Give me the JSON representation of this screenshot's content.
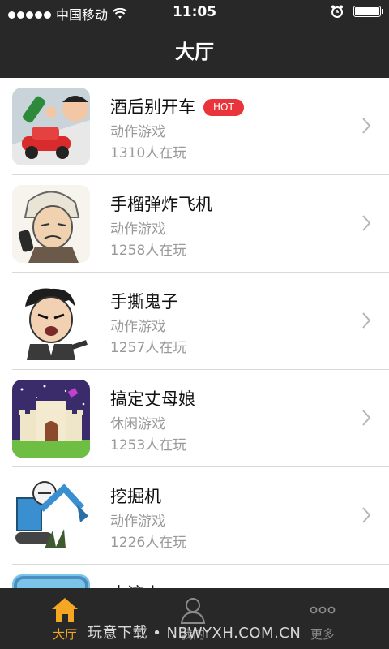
{
  "status_bar": {
    "carrier": "中国移动",
    "time": "11:05"
  },
  "nav": {
    "title": "大厅"
  },
  "games": [
    {
      "title": "酒后别开车",
      "badge": "HOT",
      "category": "动作游戏",
      "players": "1310人在玩",
      "icon": "drunk-driving-game-icon"
    },
    {
      "title": "手榴弹炸飞机",
      "category": "动作游戏",
      "players": "1258人在玩",
      "icon": "grenade-plane-game-icon"
    },
    {
      "title": "手撕鬼子",
      "category": "动作游戏",
      "players": "1257人在玩",
      "icon": "tear-enemy-game-icon"
    },
    {
      "title": "搞定丈母娘",
      "category": "休闲游戏",
      "players": "1253人在玩",
      "icon": "castle-game-icon"
    },
    {
      "title": "挖掘机",
      "category": "动作游戏",
      "players": "1226人在玩",
      "icon": "excavator-game-icon"
    },
    {
      "title": "大滚山",
      "icon": "partial-game-icon"
    }
  ],
  "tabbar": {
    "tabs": [
      {
        "label": "大厅",
        "icon": "home-icon",
        "active": true
      },
      {
        "label": "我的",
        "icon": "user-icon"
      },
      {
        "label": "更多",
        "icon": "more-icon"
      }
    ]
  },
  "watermark": "玩意下载 • NBWYXH.COM.CN",
  "colors": {
    "bar": "#282828",
    "accent": "#f5a623",
    "hot": "#e8343a"
  }
}
